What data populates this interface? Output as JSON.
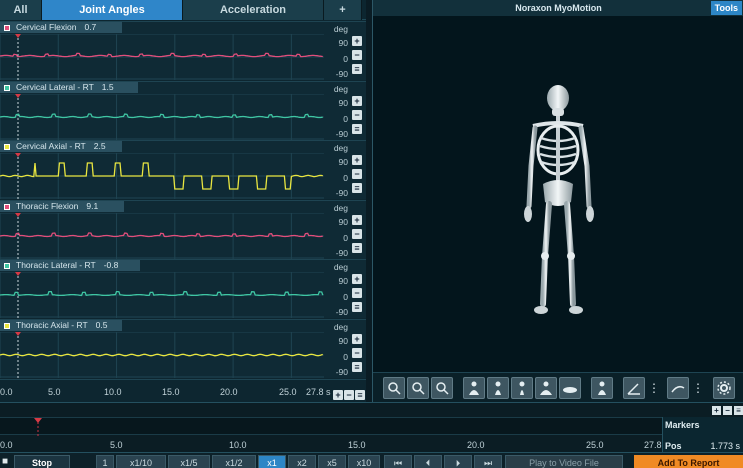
{
  "tabs": [
    "All",
    "Joint Angles",
    "Acceleration",
    "+"
  ],
  "active_tab": 1,
  "plots": [
    {
      "label": "Cervical Flexion",
      "value": "0.7",
      "color": "#e24e7b",
      "signal": "flat-low"
    },
    {
      "label": "Cervical Lateral - RT",
      "value": "1.5",
      "color": "#3fc6a3",
      "signal": "flat"
    },
    {
      "label": "Cervical Axial - RT",
      "value": "2.5",
      "color": "#e9e640",
      "signal": "pulses"
    },
    {
      "label": "Thoracic Flexion",
      "value": "9.1",
      "color": "#e24e7b",
      "signal": "flat"
    },
    {
      "label": "Thoracic Lateral - RT",
      "value": "-0.8",
      "color": "#3fc6a3",
      "signal": "small-pulses"
    },
    {
      "label": "Thoracic Axial - RT",
      "value": "0.5",
      "color": "#e9e640",
      "signal": "flat-noise"
    }
  ],
  "axis": {
    "unit": "deg",
    "top": "90",
    "mid": "0",
    "bottom": "-90"
  },
  "time_axis": {
    "ticks": [
      "0.0",
      "5.0",
      "10.0",
      "15.0",
      "20.0",
      "25.0"
    ],
    "end": "27.8 s"
  },
  "right_panel": {
    "title": "Noraxon MyoMotion",
    "tools": "Tools"
  },
  "timeline": {
    "ticks": [
      "0.0",
      "5.0",
      "10.0",
      "15.0",
      "20.0",
      "25.0"
    ],
    "end": "27.8"
  },
  "markers": {
    "title": "Markers",
    "pos_label": "Pos",
    "pos_value": "1.773 s"
  },
  "transport": {
    "stop": "Stop",
    "one": "1",
    "speeds": [
      "x1/10",
      "x1/5",
      "x1/2",
      "x1",
      "x2",
      "x5",
      "x10"
    ],
    "active_speed": "x1",
    "play_video": "Play to Video File",
    "add_report": "Add To Report"
  }
}
